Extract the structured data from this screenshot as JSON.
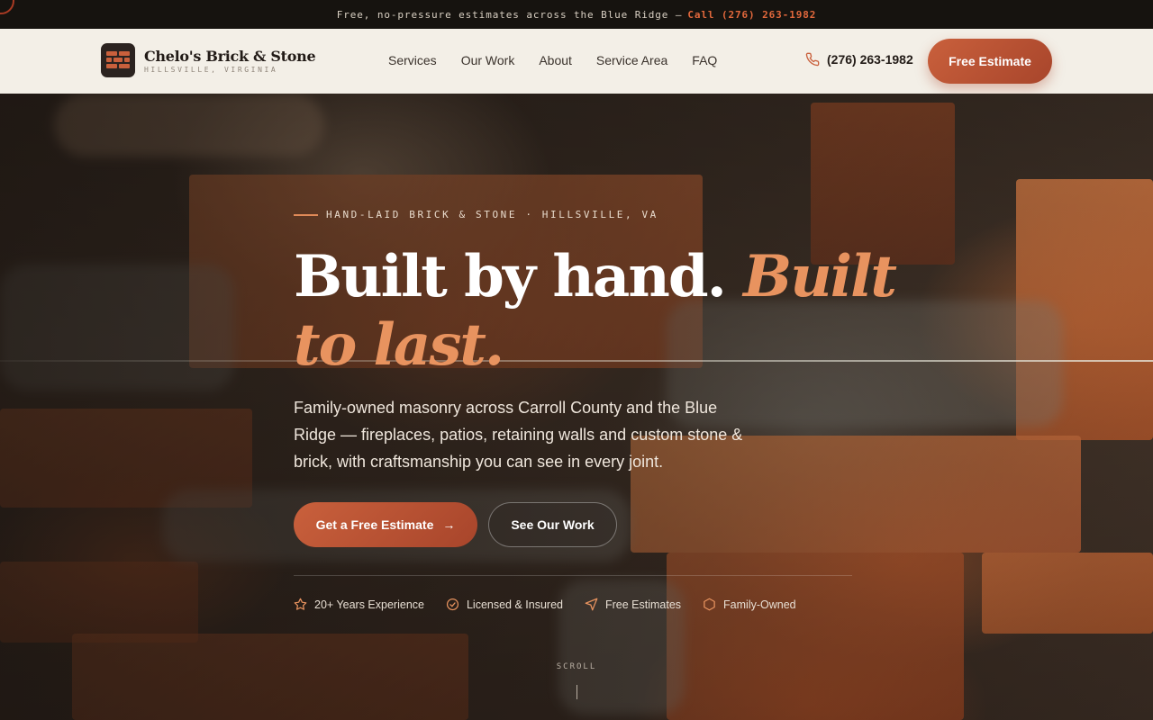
{
  "topbar": {
    "message": "Free, no-pressure estimates across the Blue Ridge —",
    "call_text": "Call (276) 263-1982"
  },
  "brand": {
    "name": "Chelo's Brick & Stone",
    "location": "HILLSVILLE, VIRGINIA",
    "logo_icon": "brick-wall-icon"
  },
  "nav": {
    "items": [
      "Services",
      "Our Work",
      "About",
      "Service Area",
      "FAQ"
    ]
  },
  "header": {
    "phone_icon": "phone-icon",
    "phone": "(276) 263-1982",
    "cta": "Free Estimate"
  },
  "hero": {
    "eyebrow": "HAND-LAID BRICK & STONE · HILLSVILLE, VA",
    "headline_main": "Built by hand. ",
    "headline_accent": "Built to last.",
    "subtext": "Family-owned masonry across Carroll County and the Blue Ridge — fireplaces, patios, retaining walls and custom stone & brick, with craftsmanship you can see in every joint.",
    "primary_cta": "Get a Free Estimate",
    "secondary_cta": "See Our Work",
    "trust": [
      {
        "label": "20+ Years Experience",
        "icon": "star-icon"
      },
      {
        "label": "Licensed & Insured",
        "icon": "check-circle-icon"
      },
      {
        "label": "Free Estimates",
        "icon": "send-icon"
      },
      {
        "label": "Family-Owned",
        "icon": "shield-icon"
      }
    ],
    "scroll_label": "SCROLL"
  },
  "colors": {
    "accent": "#c9603c",
    "accent_light": "#e8935f",
    "topbar_bg": "#16130f",
    "header_bg": "#f3efe7"
  }
}
